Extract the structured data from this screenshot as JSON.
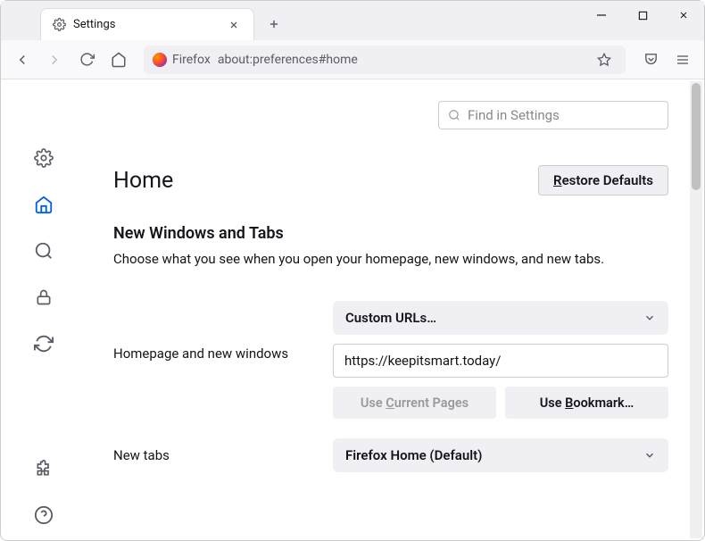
{
  "tab": {
    "label": "Settings"
  },
  "urlbar": {
    "identity": "Firefox",
    "url": "about:preferences#home"
  },
  "search": {
    "placeholder": "Find in Settings"
  },
  "page": {
    "title": "Home"
  },
  "restore": {
    "prefix": "R",
    "rest": "estore Defaults"
  },
  "section": {
    "title": "New Windows and Tabs",
    "desc": "Choose what you see when you open your homepage, new windows, and new tabs."
  },
  "homepage": {
    "label": "Homepage and new windows",
    "select": "Custom URLs…",
    "value": "https://keepitsmart.today/",
    "useCurrentPrefix": "Use ",
    "useCurrentU": "C",
    "useCurrentRest": "urrent Pages",
    "useBookmarkPrefix": "Use ",
    "useBookmarkU": "B",
    "useBookmarkRest": "ookmark…"
  },
  "newtabs": {
    "label": "New tabs",
    "select": "Firefox Home (Default)"
  }
}
